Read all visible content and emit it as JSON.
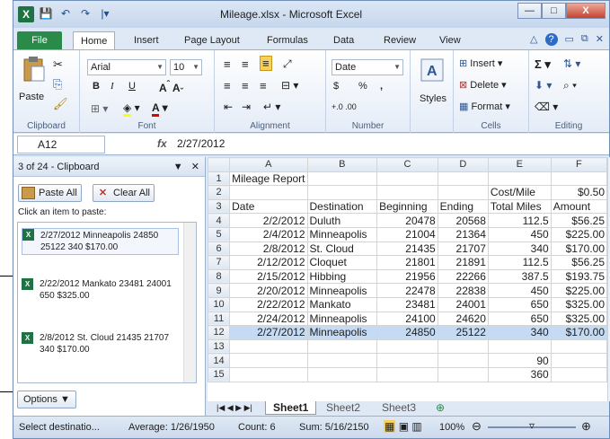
{
  "window": {
    "title": "Mileage.xlsx - Microsoft Excel",
    "minimize": "—",
    "restore": "□",
    "close": "X"
  },
  "qat": {
    "save": "💾",
    "undo": "↶",
    "redo": "↷",
    "customize": "|▾"
  },
  "tabs": {
    "file": "File",
    "items": [
      "Home",
      "Insert",
      "Page Layout",
      "Formulas",
      "Data",
      "Review",
      "View"
    ]
  },
  "ribbon": {
    "clipboard": {
      "label": "Clipboard",
      "paste": "Paste"
    },
    "font": {
      "label": "Font",
      "name": "Arial",
      "size": "10",
      "bold": "B",
      "italic": "I",
      "underline": "U"
    },
    "alignment": {
      "label": "Alignment"
    },
    "number": {
      "label": "Number",
      "format": "Date",
      "currency": "$",
      "percent": "%",
      "comma": ",",
      "inc": "←.0 .00",
      "dec": ".00 →.0"
    },
    "styles": {
      "label": "Styles"
    },
    "cells": {
      "label": "Cells",
      "insert": "Insert",
      "delete": "Delete",
      "format": "Format"
    },
    "editing": {
      "label": "Editing"
    }
  },
  "formula_bar": {
    "name_box": "A12",
    "fx": "fx",
    "content": "2/27/2012"
  },
  "clipboard_pane": {
    "header": "3 of 24 - Clipboard",
    "paste_all": "Paste All",
    "clear_all": "Clear All",
    "instruction": "Click an item to paste:",
    "items": [
      "2/27/2012 Minneapolis 24850 25122 340 $170.00",
      "2/22/2012 Mankato 23481 24001 650 $325.00",
      "2/8/2012 St. Cloud 21435 21707 340 $170.00"
    ],
    "options": "Options ▼"
  },
  "sheet": {
    "columns": [
      "A",
      "B",
      "C",
      "D",
      "E",
      "F"
    ],
    "rows": [
      {
        "n": "1",
        "c": [
          "Mileage Report",
          "",
          "",
          "",
          "",
          ""
        ]
      },
      {
        "n": "2",
        "c": [
          "",
          "",
          "",
          "",
          "Cost/Mile",
          "$0.50"
        ]
      },
      {
        "n": "3",
        "c": [
          "Date",
          "Destination",
          "Beginning",
          "Ending",
          "Total Miles",
          "Amount"
        ]
      },
      {
        "n": "4",
        "c": [
          "2/2/2012",
          "Duluth",
          "20478",
          "20568",
          "112.5",
          "$56.25"
        ]
      },
      {
        "n": "5",
        "c": [
          "2/4/2012",
          "Minneapolis",
          "21004",
          "21364",
          "450",
          "$225.00"
        ]
      },
      {
        "n": "6",
        "c": [
          "2/8/2012",
          "St. Cloud",
          "21435",
          "21707",
          "340",
          "$170.00"
        ]
      },
      {
        "n": "7",
        "c": [
          "2/12/2012",
          "Cloquet",
          "21801",
          "21891",
          "112.5",
          "$56.25"
        ]
      },
      {
        "n": "8",
        "c": [
          "2/15/2012",
          "Hibbing",
          "21956",
          "22266",
          "387.5",
          "$193.75"
        ]
      },
      {
        "n": "9",
        "c": [
          "2/20/2012",
          "Minneapolis",
          "22478",
          "22838",
          "450",
          "$225.00"
        ]
      },
      {
        "n": "10",
        "c": [
          "2/22/2012",
          "Mankato",
          "23481",
          "24001",
          "650",
          "$325.00"
        ]
      },
      {
        "n": "11",
        "c": [
          "2/24/2012",
          "Minneapolis",
          "24100",
          "24620",
          "650",
          "$325.00"
        ]
      },
      {
        "n": "12",
        "c": [
          "2/27/2012",
          "Minneapolis",
          "24850",
          "25122",
          "340",
          "$170.00"
        ]
      },
      {
        "n": "13",
        "c": [
          "",
          "",
          "",
          "",
          "",
          ""
        ]
      },
      {
        "n": "14",
        "c": [
          "",
          "",
          "",
          "",
          "90",
          ""
        ]
      },
      {
        "n": "15",
        "c": [
          "",
          "",
          "",
          "",
          "360",
          ""
        ]
      }
    ],
    "tabs": [
      "Sheet1",
      "Sheet2",
      "Sheet3"
    ]
  },
  "status": {
    "mode": "Select destinatio...",
    "average": "Average: 1/26/1950",
    "count": "Count: 6",
    "sum": "Sum: 5/16/2150",
    "zoom": "100%"
  }
}
